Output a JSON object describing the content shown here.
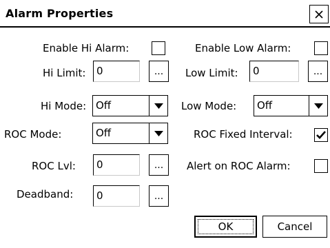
{
  "window": {
    "title": "Alarm Properties",
    "close_icon": "close-icon"
  },
  "left": {
    "enable_hi_alarm": {
      "label": "Enable Hi Alarm:",
      "checked": false
    },
    "hi_limit": {
      "label": "Hi Limit:",
      "value": "0",
      "browse_label": "..."
    },
    "hi_mode": {
      "label": "Hi Mode:",
      "value": "Off"
    },
    "roc_mode": {
      "label": "ROC Mode:",
      "value": "Off"
    },
    "roc_lvl": {
      "label": "ROC Lvl:",
      "value": "0",
      "browse_label": "..."
    },
    "deadband": {
      "label": "Deadband:",
      "value": "0",
      "browse_label": "..."
    }
  },
  "right": {
    "enable_low_alarm": {
      "label": "Enable Low Alarm:",
      "checked": false
    },
    "low_limit": {
      "label": "Low Limit:",
      "value": "0",
      "browse_label": "..."
    },
    "low_mode": {
      "label": "Low Mode:",
      "value": "Off"
    },
    "roc_fixed_interval": {
      "label": "ROC Fixed Interval:",
      "checked": true
    },
    "alert_on_roc_alarm": {
      "label": "Alert on ROC Alarm:",
      "checked": false
    }
  },
  "buttons": {
    "ok": "OK",
    "cancel": "Cancel"
  },
  "icons": {
    "dropdown": "chevron-down-icon",
    "check": "checkmark-icon"
  }
}
